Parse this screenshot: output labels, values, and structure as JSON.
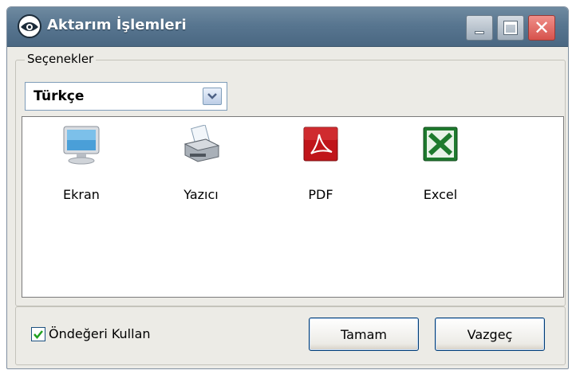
{
  "window": {
    "title": "Aktarım İşlemleri",
    "icon": "app-eye-icon",
    "controls": [
      "minimize-icon",
      "maximize-icon",
      "close-icon"
    ]
  },
  "options": {
    "group_label": "Seçenekler",
    "language_value": "Türkçe"
  },
  "export_targets": [
    {
      "label": "Ekran",
      "icon": "monitor-icon"
    },
    {
      "label": "Yazıcı",
      "icon": "printer-icon"
    },
    {
      "label": "PDF",
      "icon": "pdf-icon"
    },
    {
      "label": "Excel",
      "icon": "excel-icon"
    }
  ],
  "footer": {
    "checkbox_label": "Öndeğeri Kullan",
    "checkbox_checked": true,
    "ok_label": "Tamam",
    "cancel_label": "Vazgeç"
  },
  "colors": {
    "titlebar": "#587690",
    "close_button": "#d6524c",
    "pdf": "#c0151a",
    "excel": "#1e7a2e",
    "window_bg": "#ecebe6"
  }
}
